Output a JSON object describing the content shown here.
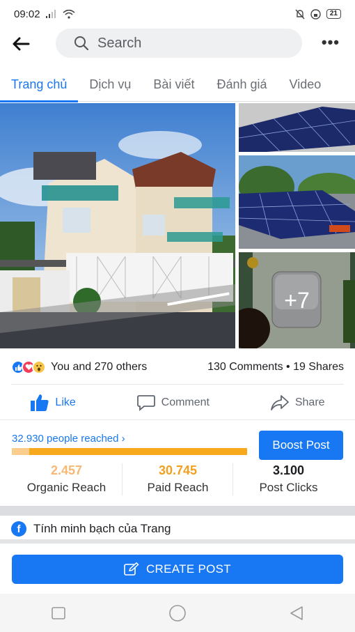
{
  "status": {
    "time": "09:02",
    "battery": "21"
  },
  "search": {
    "placeholder": "Search"
  },
  "tabs": [
    "Trang chủ",
    "Dịch vụ",
    "Bài viết",
    "Đánh giá",
    "Video"
  ],
  "photos": {
    "more_count": "+7"
  },
  "reactions": {
    "summary": "You and 270 others",
    "counts": "130 Comments • 19 Shares"
  },
  "actions": {
    "like": "Like",
    "comment": "Comment",
    "share": "Share"
  },
  "insights": {
    "reached": "32.930 people reached",
    "organic_fraction": 0.075,
    "boost": "Boost Post",
    "stats": [
      {
        "value": "2.457",
        "label": "Organic Reach",
        "color": "#f6b873"
      },
      {
        "value": "30.745",
        "label": "Paid Reach",
        "color": "#f2a021"
      },
      {
        "value": "3.100",
        "label": "Post Clicks",
        "color": "#1c1e21"
      }
    ]
  },
  "transparency": {
    "title": "Tính minh bạch của Trang"
  },
  "create_post": {
    "label": "CREATE POST"
  },
  "colors": {
    "accent": "#1877f2",
    "orange": "#f7a81c"
  }
}
